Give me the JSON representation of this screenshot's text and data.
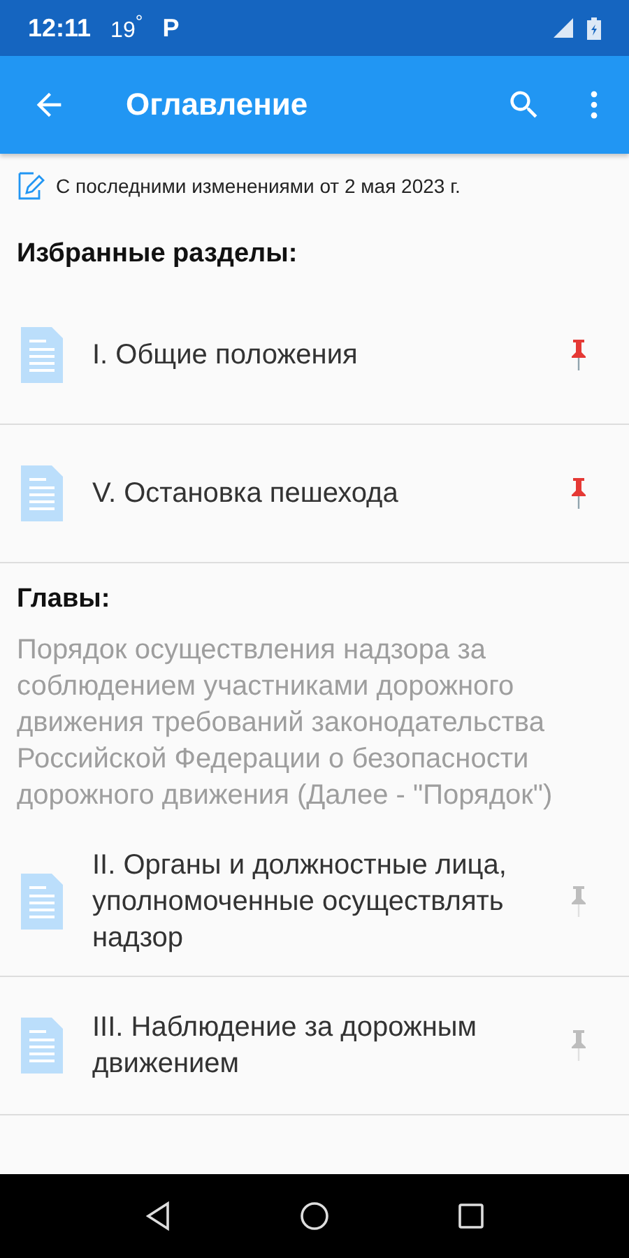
{
  "status_bar": {
    "time": "12:11",
    "temperature": "19$^{°}$",
    "notification": "P"
  },
  "app_bar": {
    "title": "Оглавление"
  },
  "update_note": "С последними изменениями от 2 мая 2023 г.",
  "favorites": {
    "heading": "Избранные разделы:",
    "items": [
      {
        "title": "I. Общие положения",
        "pinned": true
      },
      {
        "title": "V. Остановка пешехода",
        "pinned": true
      }
    ]
  },
  "chapters": {
    "heading": "Главы:",
    "preamble": "Порядок осуществления надзора за соблюдением участниками дорожного движения требований законодательства Российской Федерации о безопасности дорожного движения (Далее - \"Порядок\")",
    "items": [
      {
        "title": "II. Органы и должностные лица, уполномоченные осуществлять надзор",
        "pinned": false
      },
      {
        "title": "III. Наблюдение за дорожным движением",
        "pinned": false
      }
    ]
  }
}
